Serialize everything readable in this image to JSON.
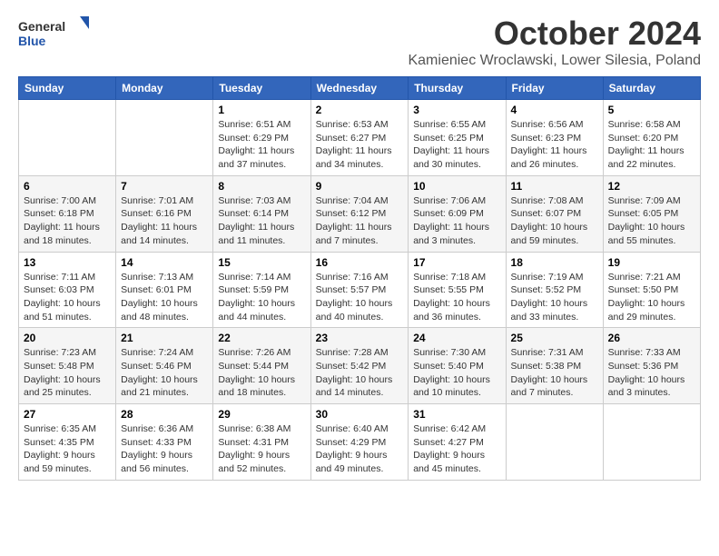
{
  "header": {
    "logo_general": "General",
    "logo_blue": "Blue",
    "month_title": "October 2024",
    "location": "Kamieniec Wroclawski, Lower Silesia, Poland"
  },
  "days_of_week": [
    "Sunday",
    "Monday",
    "Tuesday",
    "Wednesday",
    "Thursday",
    "Friday",
    "Saturday"
  ],
  "weeks": [
    [
      {
        "day": "",
        "info": ""
      },
      {
        "day": "",
        "info": ""
      },
      {
        "day": "1",
        "info": "Sunrise: 6:51 AM\nSunset: 6:29 PM\nDaylight: 11 hours and 37 minutes."
      },
      {
        "day": "2",
        "info": "Sunrise: 6:53 AM\nSunset: 6:27 PM\nDaylight: 11 hours and 34 minutes."
      },
      {
        "day": "3",
        "info": "Sunrise: 6:55 AM\nSunset: 6:25 PM\nDaylight: 11 hours and 30 minutes."
      },
      {
        "day": "4",
        "info": "Sunrise: 6:56 AM\nSunset: 6:23 PM\nDaylight: 11 hours and 26 minutes."
      },
      {
        "day": "5",
        "info": "Sunrise: 6:58 AM\nSunset: 6:20 PM\nDaylight: 11 hours and 22 minutes."
      }
    ],
    [
      {
        "day": "6",
        "info": "Sunrise: 7:00 AM\nSunset: 6:18 PM\nDaylight: 11 hours and 18 minutes."
      },
      {
        "day": "7",
        "info": "Sunrise: 7:01 AM\nSunset: 6:16 PM\nDaylight: 11 hours and 14 minutes."
      },
      {
        "day": "8",
        "info": "Sunrise: 7:03 AM\nSunset: 6:14 PM\nDaylight: 11 hours and 11 minutes."
      },
      {
        "day": "9",
        "info": "Sunrise: 7:04 AM\nSunset: 6:12 PM\nDaylight: 11 hours and 7 minutes."
      },
      {
        "day": "10",
        "info": "Sunrise: 7:06 AM\nSunset: 6:09 PM\nDaylight: 11 hours and 3 minutes."
      },
      {
        "day": "11",
        "info": "Sunrise: 7:08 AM\nSunset: 6:07 PM\nDaylight: 10 hours and 59 minutes."
      },
      {
        "day": "12",
        "info": "Sunrise: 7:09 AM\nSunset: 6:05 PM\nDaylight: 10 hours and 55 minutes."
      }
    ],
    [
      {
        "day": "13",
        "info": "Sunrise: 7:11 AM\nSunset: 6:03 PM\nDaylight: 10 hours and 51 minutes."
      },
      {
        "day": "14",
        "info": "Sunrise: 7:13 AM\nSunset: 6:01 PM\nDaylight: 10 hours and 48 minutes."
      },
      {
        "day": "15",
        "info": "Sunrise: 7:14 AM\nSunset: 5:59 PM\nDaylight: 10 hours and 44 minutes."
      },
      {
        "day": "16",
        "info": "Sunrise: 7:16 AM\nSunset: 5:57 PM\nDaylight: 10 hours and 40 minutes."
      },
      {
        "day": "17",
        "info": "Sunrise: 7:18 AM\nSunset: 5:55 PM\nDaylight: 10 hours and 36 minutes."
      },
      {
        "day": "18",
        "info": "Sunrise: 7:19 AM\nSunset: 5:52 PM\nDaylight: 10 hours and 33 minutes."
      },
      {
        "day": "19",
        "info": "Sunrise: 7:21 AM\nSunset: 5:50 PM\nDaylight: 10 hours and 29 minutes."
      }
    ],
    [
      {
        "day": "20",
        "info": "Sunrise: 7:23 AM\nSunset: 5:48 PM\nDaylight: 10 hours and 25 minutes."
      },
      {
        "day": "21",
        "info": "Sunrise: 7:24 AM\nSunset: 5:46 PM\nDaylight: 10 hours and 21 minutes."
      },
      {
        "day": "22",
        "info": "Sunrise: 7:26 AM\nSunset: 5:44 PM\nDaylight: 10 hours and 18 minutes."
      },
      {
        "day": "23",
        "info": "Sunrise: 7:28 AM\nSunset: 5:42 PM\nDaylight: 10 hours and 14 minutes."
      },
      {
        "day": "24",
        "info": "Sunrise: 7:30 AM\nSunset: 5:40 PM\nDaylight: 10 hours and 10 minutes."
      },
      {
        "day": "25",
        "info": "Sunrise: 7:31 AM\nSunset: 5:38 PM\nDaylight: 10 hours and 7 minutes."
      },
      {
        "day": "26",
        "info": "Sunrise: 7:33 AM\nSunset: 5:36 PM\nDaylight: 10 hours and 3 minutes."
      }
    ],
    [
      {
        "day": "27",
        "info": "Sunrise: 6:35 AM\nSunset: 4:35 PM\nDaylight: 9 hours and 59 minutes."
      },
      {
        "day": "28",
        "info": "Sunrise: 6:36 AM\nSunset: 4:33 PM\nDaylight: 9 hours and 56 minutes."
      },
      {
        "day": "29",
        "info": "Sunrise: 6:38 AM\nSunset: 4:31 PM\nDaylight: 9 hours and 52 minutes."
      },
      {
        "day": "30",
        "info": "Sunrise: 6:40 AM\nSunset: 4:29 PM\nDaylight: 9 hours and 49 minutes."
      },
      {
        "day": "31",
        "info": "Sunrise: 6:42 AM\nSunset: 4:27 PM\nDaylight: 9 hours and 45 minutes."
      },
      {
        "day": "",
        "info": ""
      },
      {
        "day": "",
        "info": ""
      }
    ]
  ]
}
